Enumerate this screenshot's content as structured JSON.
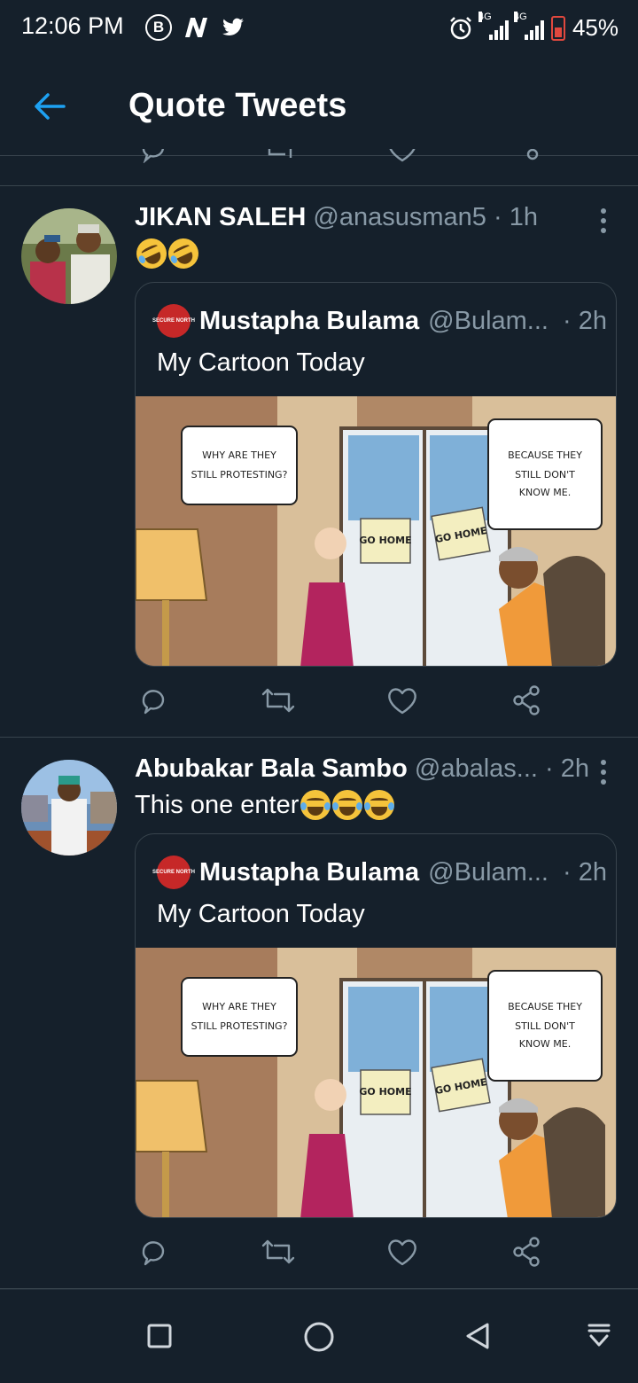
{
  "status_bar": {
    "time": "12:06 PM",
    "battery": "45%",
    "network_1": "4G",
    "network_2": "4G",
    "icons": [
      "b-circle-icon",
      "n-icon",
      "twitter-icon",
      "alarm-icon",
      "signal-icon",
      "battery-icon"
    ]
  },
  "header": {
    "title": "Quote Tweets",
    "back_icon": "arrow-left-icon"
  },
  "colors": {
    "background": "#15202b",
    "accent": "#1da1f2",
    "muted": "#8899a6",
    "divider": "#38444d"
  },
  "tweets": [
    {
      "name": "JIKAN SALEH",
      "handle": "@anasusman5",
      "time": "· 1h",
      "text": "",
      "emojis": [
        "rolling-on-floor-laughing",
        "rolling-on-floor-laughing"
      ],
      "quote": {
        "logo_text": "SECURE NORTH",
        "name": "Mustapha Bulama",
        "handle": "@Bulam...",
        "time": "· 2h",
        "text": "My Cartoon Today",
        "cartoon": {
          "bubble_left": "WHY ARE THEY STILL PROTESTING?",
          "bubble_right": "BECAUSE THEY STILL DON'T KNOW ME.",
          "sign_1": "GO HOME",
          "sign_2": "GO HOME"
        }
      }
    },
    {
      "name": "Abubakar Bala Sambo",
      "handle": "@abalas...",
      "time": "· 2h",
      "text": "This one enter",
      "emojis": [
        "face-with-tears-of-joy",
        "face-with-tears-of-joy",
        "face-with-tears-of-joy"
      ],
      "quote": {
        "logo_text": "SECURE NORTH",
        "name": "Mustapha Bulama",
        "handle": "@Bulam...",
        "time": "· 2h",
        "text": "My Cartoon Today",
        "cartoon": {
          "bubble_left": "WHY ARE THEY STILL PROTESTING?",
          "bubble_right": "BECAUSE THEY STILL DON'T KNOW ME.",
          "sign_1": "GO HOME",
          "sign_2": "GO HOME"
        }
      }
    }
  ],
  "action_icons": [
    "reply-icon",
    "retweet-icon",
    "like-icon",
    "share-icon"
  ],
  "nav_icons": [
    "recents-square-icon",
    "home-circle-icon",
    "back-triangle-icon",
    "notification-pull-icon"
  ]
}
